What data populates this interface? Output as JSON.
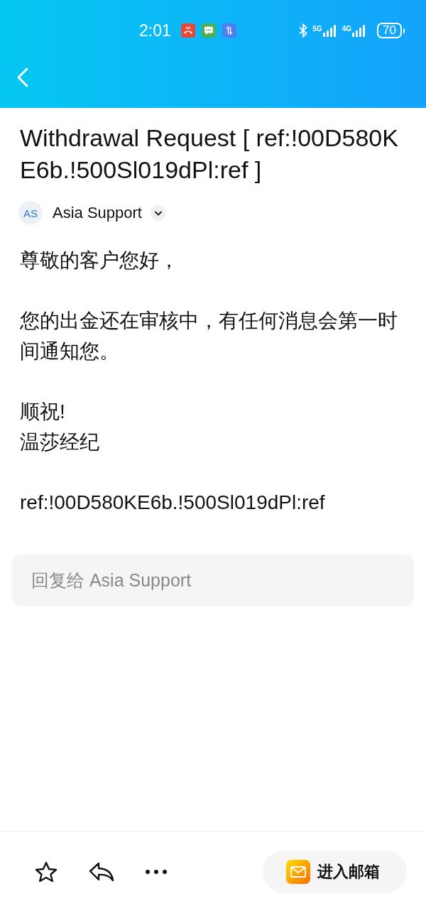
{
  "status_bar": {
    "time": "2:01",
    "notifications": [
      {
        "kind": "missed_call"
      },
      {
        "kind": "message"
      },
      {
        "kind": "data"
      }
    ],
    "networks": [
      {
        "label": "5G"
      },
      {
        "label": "4G"
      }
    ],
    "battery": "70"
  },
  "email": {
    "subject": "Withdrawal Request [ ref:!00D580KE6b.!500Sl019dPl:ref ]",
    "sender": {
      "initials": "AS",
      "name": "Asia Support"
    },
    "paragraphs": [
      {
        "lines": [
          "尊敬的客户您好，"
        ]
      },
      {
        "lines": [
          "您的出金还在审核中，有任何消息会第一时间通知您。"
        ]
      },
      {
        "lines": [
          "顺祝!",
          "温莎经纪"
        ]
      },
      {
        "lines": [
          "ref:!00D580KE6b.!500Sl019dPl:ref"
        ]
      }
    ]
  },
  "reply": {
    "placeholder": "回复给 Asia Support"
  },
  "toolbar": {
    "actions": [
      {
        "kind": "star"
      },
      {
        "kind": "reply"
      },
      {
        "kind": "more"
      }
    ],
    "open_mailbox": "进入邮箱"
  }
}
